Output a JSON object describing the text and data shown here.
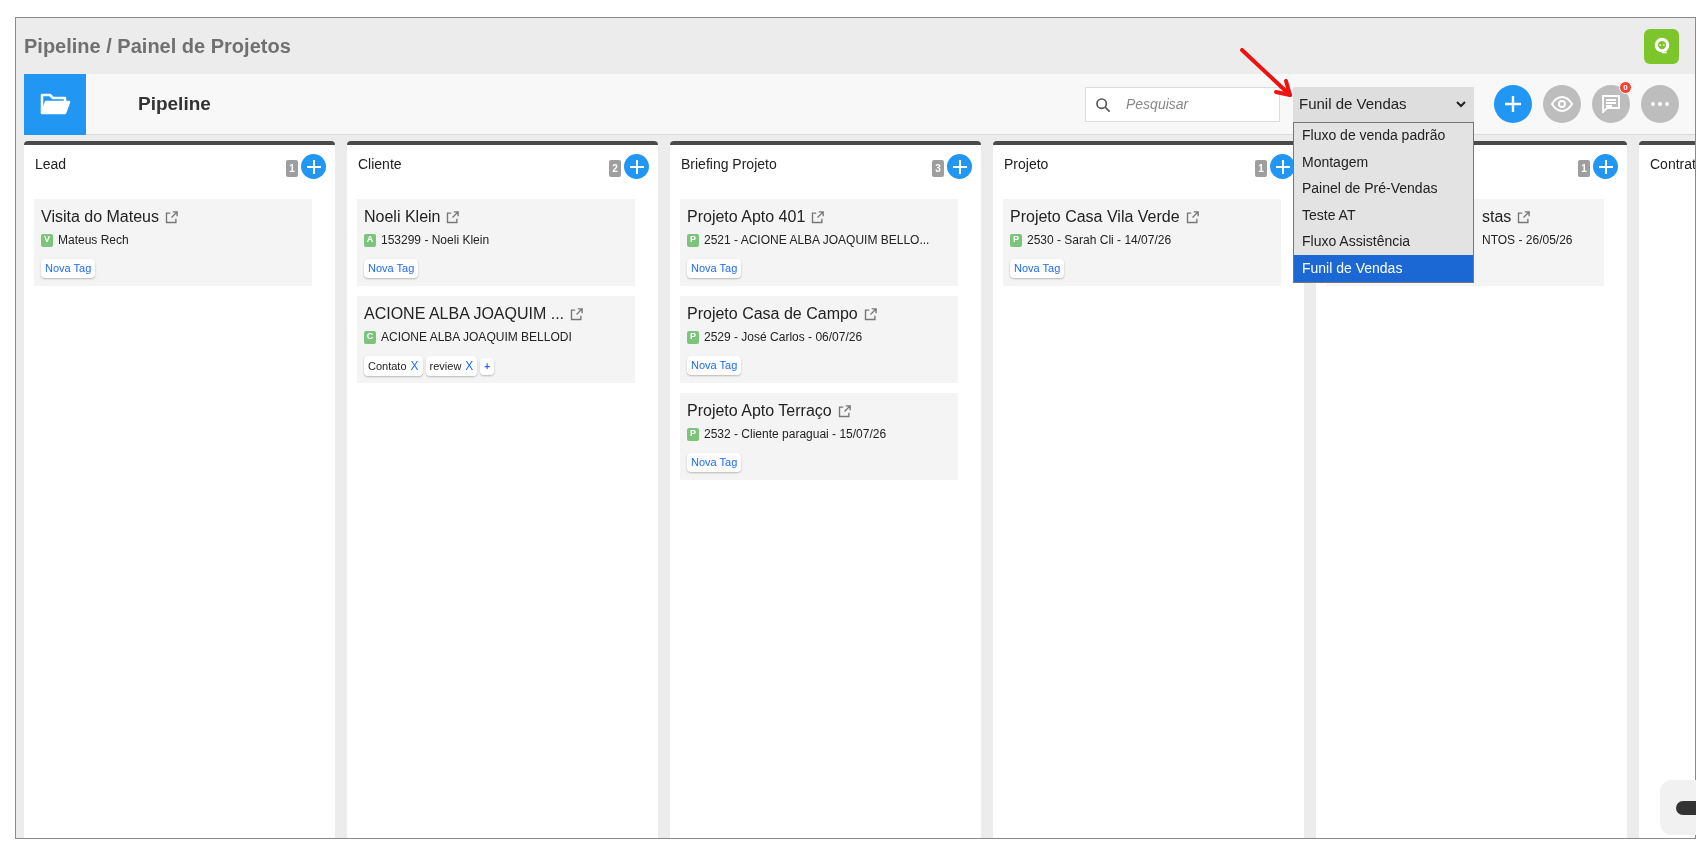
{
  "page_title": "Pipeline / Painel de Projetos",
  "toolbar": {
    "title": "Pipeline",
    "search": {
      "placeholder": "Pesquisar"
    },
    "pipeline_select": {
      "value": "Funil de Vendas",
      "expanded": true,
      "options": [
        {
          "label": "Fluxo de venda padrão",
          "selected": false
        },
        {
          "label": "Montagem",
          "selected": false
        },
        {
          "label": "Painel de Pré-Vendas",
          "selected": false
        },
        {
          "label": "Teste AT",
          "selected": false
        },
        {
          "label": "Fluxo Assistência",
          "selected": false
        },
        {
          "label": "Funil de Vendas",
          "selected": true
        }
      ]
    },
    "notifications_badge": "0"
  },
  "columns": [
    {
      "title": "Lead",
      "count": "1",
      "cards": [
        {
          "title": "Visita do Mateus",
          "letter": "V",
          "subtitle": "Mateus Rech",
          "tags": [
            {
              "kind": "new",
              "label": "Nova Tag"
            }
          ]
        }
      ]
    },
    {
      "title": "Cliente",
      "count": "2",
      "cards": [
        {
          "title": "Noeli Klein",
          "letter": "A",
          "subtitle": "153299 - Noeli Klein",
          "tags": [
            {
              "kind": "new",
              "label": "Nova Tag"
            }
          ]
        },
        {
          "title": "ACIONE ALBA JOAQUIM ...",
          "letter": "C",
          "subtitle": "ACIONE ALBA JOAQUIM BELLODI",
          "tags": [
            {
              "kind": "label",
              "label": "Contato",
              "remove": "X"
            },
            {
              "kind": "label",
              "label": "review",
              "remove": "X"
            },
            {
              "kind": "add",
              "label": "+"
            }
          ]
        }
      ]
    },
    {
      "title": "Briefing Projeto",
      "count": "3",
      "cards": [
        {
          "title": "Projeto Apto 401",
          "letter": "P",
          "subtitle": "2521 - ACIONE ALBA JOAQUIM BELLO...",
          "tags": [
            {
              "kind": "new",
              "label": "Nova Tag"
            }
          ]
        },
        {
          "title": "Projeto Casa de Campo",
          "letter": "P",
          "subtitle": "2529 - José Carlos - 06/07/26",
          "tags": [
            {
              "kind": "new",
              "label": "Nova Tag"
            }
          ]
        },
        {
          "title": "Projeto Apto Terraço",
          "letter": "P",
          "subtitle": "2532 - Cliente paraguai - 15/07/26",
          "tags": [
            {
              "kind": "new",
              "label": "Nova Tag"
            }
          ]
        }
      ]
    },
    {
      "title": "Projeto",
      "count": "1",
      "cards": [
        {
          "title": "Projeto Casa Vila Verde",
          "letter": "P",
          "subtitle": "2530 - Sarah Cli - 14/07/26",
          "tags": [
            {
              "kind": "new",
              "label": "Nova Tag"
            }
          ]
        }
      ]
    },
    {
      "count": "1",
      "cards": [
        {
          "title": "stas",
          "subtitle": "NTOS - 26/05/26",
          "clipped": true
        }
      ]
    },
    {
      "title": "Contrat"
    }
  ]
}
